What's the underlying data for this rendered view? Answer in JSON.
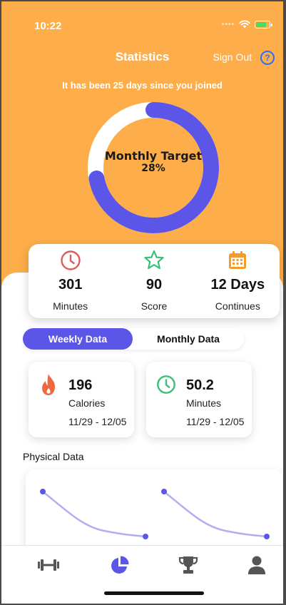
{
  "status_bar": {
    "time": "10:22"
  },
  "header": {
    "title": "Statistics",
    "sign_out": "Sign Out",
    "help": "?"
  },
  "joined_text": "It has been 25 days since you joined",
  "monthly_target": {
    "label": "Monthly Target",
    "percent_text": "28%",
    "progress": 0.72
  },
  "summary": [
    {
      "icon": "clock-icon",
      "value": "301",
      "label": "Minutes",
      "color": "#e05a5a"
    },
    {
      "icon": "star-icon",
      "value": "90",
      "label": "Score",
      "color": "#3bbf7a"
    },
    {
      "icon": "calendar-icon",
      "value": "12 Days",
      "label": "Continues",
      "color": "#f39c2c"
    }
  ],
  "tabs": {
    "weekly": "Weekly Data",
    "monthly": "Monthly Data"
  },
  "cards": [
    {
      "icon": "flame-icon",
      "value": "196",
      "label": "Calories",
      "range": "11/29 - 12/05"
    },
    {
      "icon": "clock-icon",
      "value": "50.2",
      "label": "Minutes",
      "range": "11/29 - 12/05"
    }
  ],
  "physical_title": "Physical Data",
  "colors": {
    "orange": "#fdae4a",
    "accent": "#5b55e8",
    "ring_track": "#ffffff"
  },
  "tabbar": [
    {
      "icon": "dumbbell-icon",
      "active": false
    },
    {
      "icon": "pie-chart-icon",
      "active": true
    },
    {
      "icon": "trophy-icon",
      "active": false
    },
    {
      "icon": "profile-icon",
      "active": false
    }
  ]
}
